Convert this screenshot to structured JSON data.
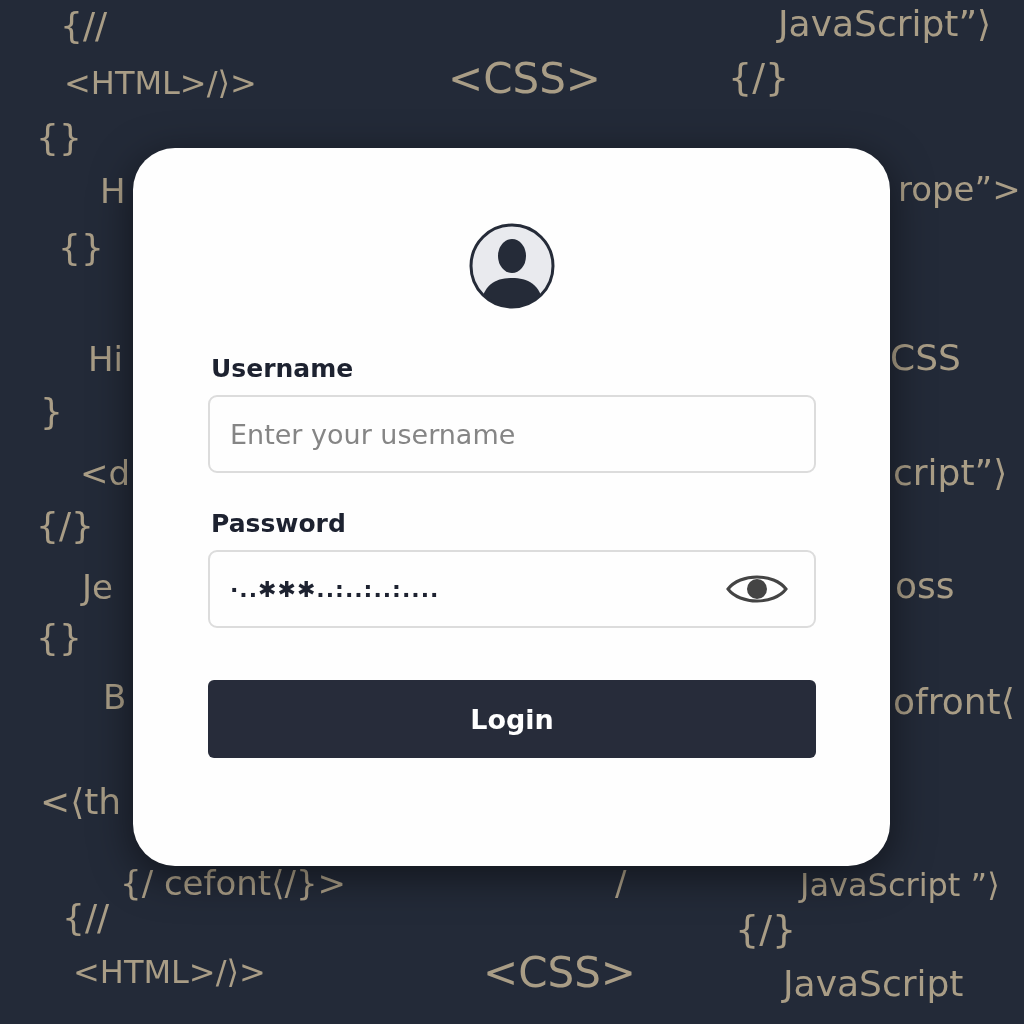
{
  "background_code": [
    "{//",
    "JavaScript”⟩",
    "<HTML>/⟩>",
    "<CSS>",
    "{/}",
    "{}",
    "H",
    "rope”>",
    "{}",
    "Hi",
    "CSS",
    "}",
    "<d",
    "cript”⟩",
    "{/}",
    "Je",
    "oss",
    "{}",
    "B",
    "ofront⟨",
    "<⟨th",
    "{/ cefont⟨/}>",
    "/",
    "JavaScript ”⟩",
    "{//",
    "{/}",
    "<HTML>/⟩>",
    "<CSS>",
    "JavaScript"
  ],
  "login": {
    "username_label": "Username",
    "username": {
      "placeholder": "Enter your username"
    },
    "password_label": "Password",
    "password": {
      "value": "·..✱✱✱..:..:..:...."
    },
    "button": "Login"
  }
}
